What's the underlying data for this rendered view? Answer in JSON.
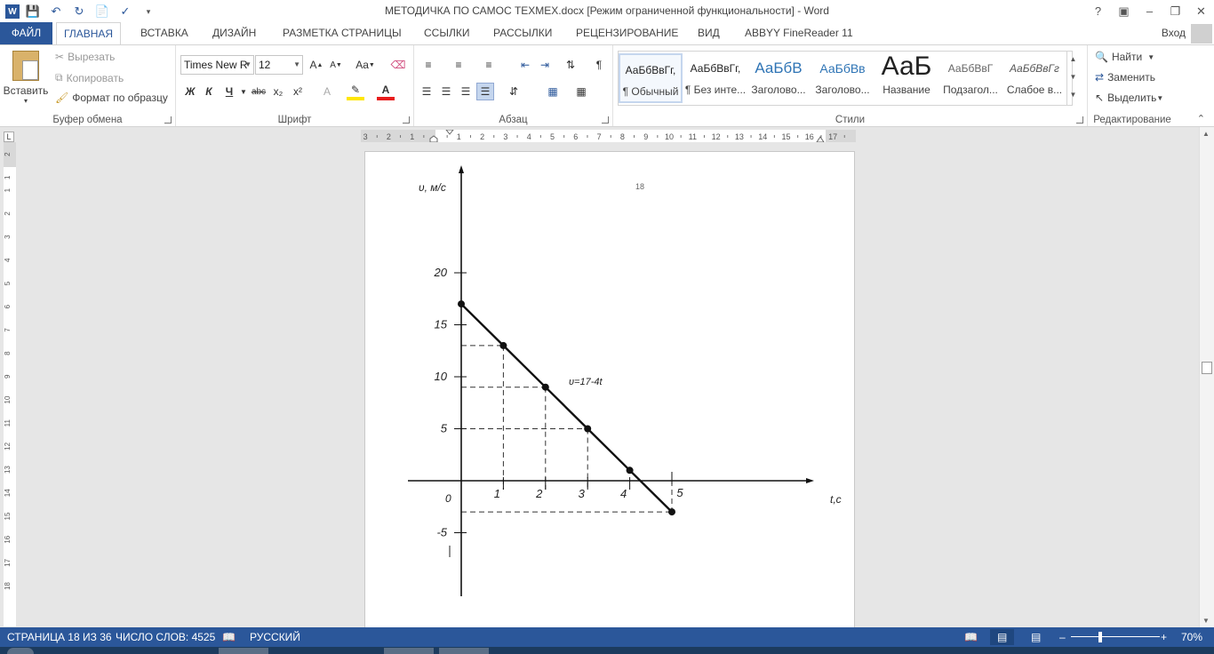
{
  "window": {
    "title": "МЕТОДИЧКА ПО САМОС ТЕХМЕХ.docx [Режим ограниченной функциональности] - Word",
    "help": "?",
    "minimize": "–",
    "restore": "❐",
    "close": "✕"
  },
  "tabs": [
    {
      "label": "ФАЙЛ"
    },
    {
      "label": "ГЛАВНАЯ"
    },
    {
      "label": "ВСТАВКА"
    },
    {
      "label": "ДИЗАЙН"
    },
    {
      "label": "РАЗМЕТКА СТРАНИЦЫ"
    },
    {
      "label": "ССЫЛКИ"
    },
    {
      "label": "РАССЫЛКИ"
    },
    {
      "label": "РЕЦЕНЗИРОВАНИЕ"
    },
    {
      "label": "ВИД"
    },
    {
      "label": "ABBYY FineReader 11"
    }
  ],
  "signin": "Вход",
  "clipboard": {
    "paste": "Вставить",
    "cut": "Вырезать",
    "copy": "Копировать",
    "format_painter": "Формат по образцу",
    "group": "Буфер обмена"
  },
  "font": {
    "name": "Times New R",
    "size": "12",
    "group": "Шрифт",
    "bold": "Ж",
    "italic": "К",
    "underline": "Ч",
    "strike": "abc",
    "sub": "x₂",
    "sup": "x²",
    "grow": "A",
    "shrink": "A",
    "case": "Aa"
  },
  "paragraph": {
    "group": "Абзац",
    "pilcrow": "¶"
  },
  "styles": {
    "group": "Стили",
    "items": [
      {
        "preview": "АаБбВвГг,",
        "name": "¶ Обычный"
      },
      {
        "preview": "АаБбВвГг,",
        "name": "¶ Без инте..."
      },
      {
        "preview": "АаБбВ",
        "name": "Заголово..."
      },
      {
        "preview": "АаБбВв",
        "name": "Заголово..."
      },
      {
        "preview": "АаБ",
        "name": "Название"
      },
      {
        "preview": "АаБбВвГ",
        "name": "Подзагол..."
      },
      {
        "preview": "АаБбВвГг",
        "name": "Слабое в..."
      }
    ]
  },
  "editing": {
    "find": "Найти",
    "replace": "Заменить",
    "select": "Выделить",
    "group": "Редактирование"
  },
  "ruler": {
    "h_labels": [
      "3",
      "2",
      "1",
      "1",
      "2",
      "3",
      "4",
      "5",
      "6",
      "7",
      "8",
      "9",
      "10",
      "11",
      "12",
      "13",
      "14",
      "15",
      "16",
      "17"
    ],
    "v_labels": [
      "2",
      "1",
      "1",
      "2",
      "3",
      "4",
      "5",
      "6",
      "7",
      "8",
      "9",
      "10",
      "11",
      "12",
      "13",
      "14",
      "15",
      "16",
      "17",
      "18"
    ]
  },
  "document": {
    "page_number": "18",
    "chart_data": {
      "type": "line",
      "title": "",
      "xlabel": "t,c",
      "ylabel": "υ, м/с",
      "annotation": "υ=17-4t",
      "origin_label": "0",
      "x_ticks": [
        "1",
        "2",
        "3",
        "4",
        "5"
      ],
      "y_ticks": [
        "20",
        "15",
        "10",
        "5",
        "-5"
      ],
      "xlim": [
        0,
        6
      ],
      "ylim": [
        -10,
        27
      ],
      "series": [
        {
          "x": [
            0,
            1,
            2,
            3,
            4,
            5
          ],
          "y": [
            17,
            13,
            9,
            5,
            1,
            -3
          ]
        }
      ]
    }
  },
  "status": {
    "page": "СТРАНИЦА 18 ИЗ 36",
    "words": "ЧИСЛО СЛОВ: 4525",
    "language": "РУССКИЙ",
    "zoom": "70%"
  }
}
